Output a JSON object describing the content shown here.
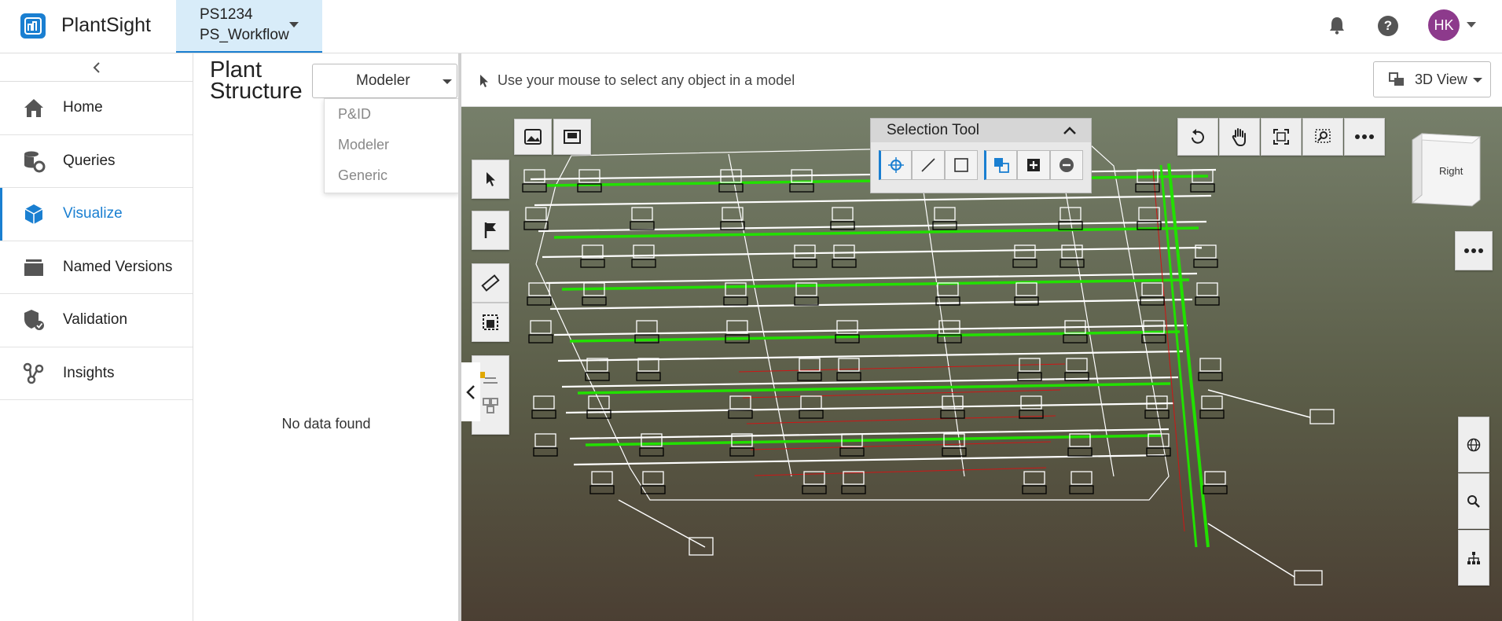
{
  "app": {
    "title": "PlantSight"
  },
  "project": {
    "id": "PS1234",
    "name": "PS_Workflow"
  },
  "user": {
    "initials": "HK"
  },
  "sidebar": {
    "items": [
      {
        "label": "Home",
        "icon": "home-icon"
      },
      {
        "label": "Queries",
        "icon": "database-gear-icon"
      },
      {
        "label": "Visualize",
        "icon": "cube-icon",
        "active": true
      },
      {
        "label": "Named Versions",
        "icon": "layers-icon"
      },
      {
        "label": "Validation",
        "icon": "validation-icon"
      },
      {
        "label": "Insights",
        "icon": "insights-icon"
      }
    ]
  },
  "panel": {
    "title": "Plant Structure",
    "dropdown_value": "Modeler",
    "options": [
      "P&ID",
      "Modeler",
      "Generic"
    ],
    "empty_text": "No data found"
  },
  "viewer": {
    "hint": "Use your mouse to select any object in a model",
    "view_mode": "3D View",
    "selection_tool_title": "Selection Tool",
    "cube_face": "Right"
  },
  "colors": {
    "accent": "#1a7fd1",
    "avatar": "#8d3a8c",
    "pipe_green": "#22e000",
    "pipe_red": "#d01515"
  }
}
